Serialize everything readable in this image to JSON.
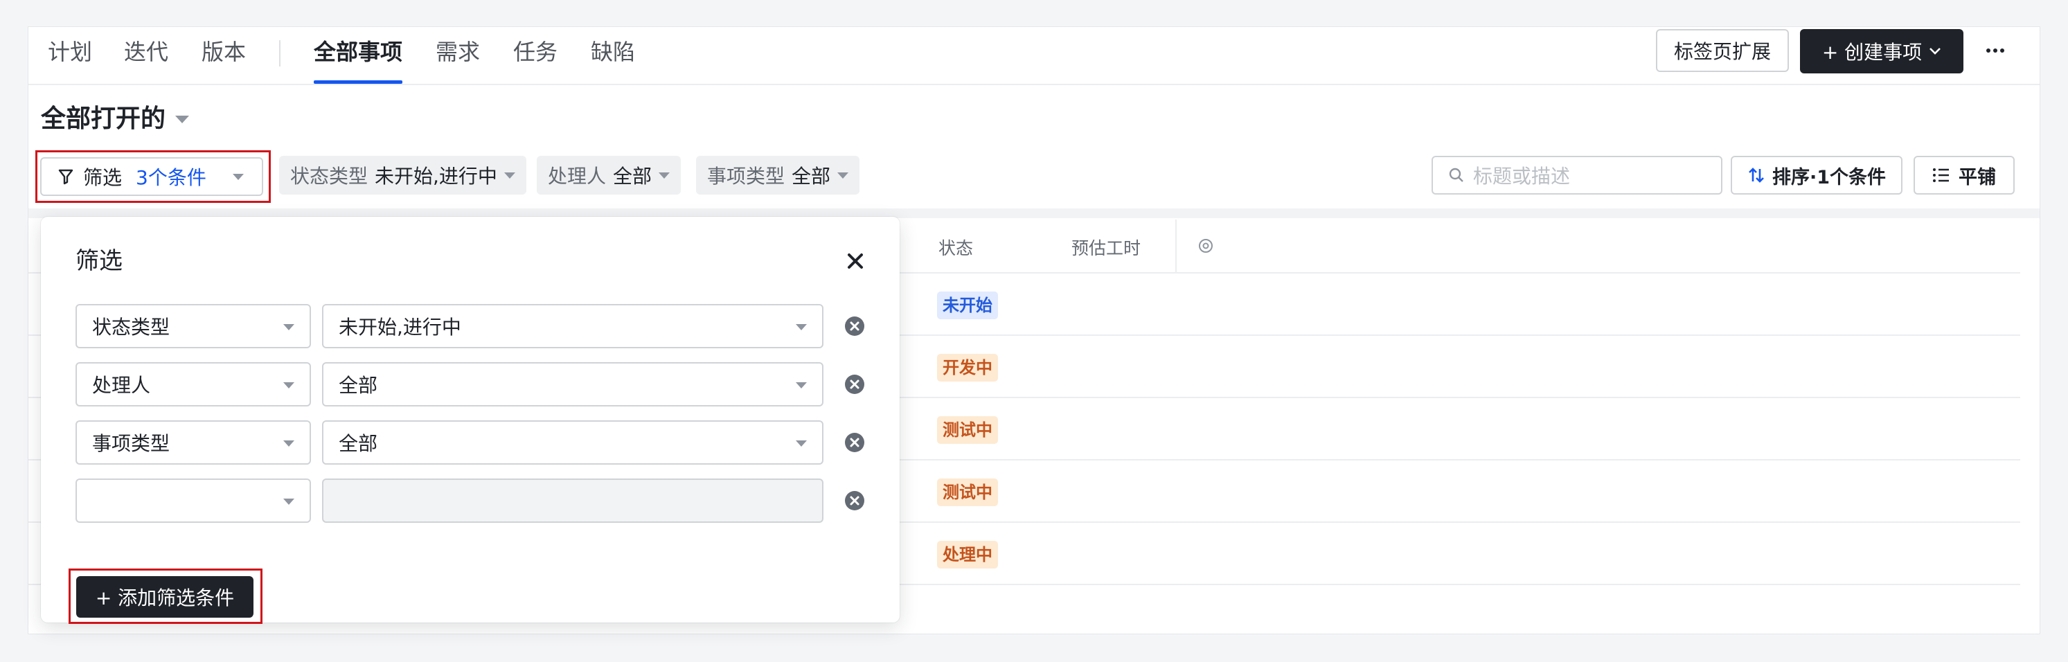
{
  "nav": {
    "items": [
      {
        "label": "计划"
      },
      {
        "label": "迭代"
      },
      {
        "label": "版本"
      },
      {
        "label": "全部事项"
      },
      {
        "label": "需求"
      },
      {
        "label": "任务"
      },
      {
        "label": "缺陷"
      }
    ],
    "active_index": 3,
    "tab_expand_label": "标签页扩展",
    "create_label": "+ 创建事项"
  },
  "view": {
    "title": "全部打开的"
  },
  "filter_bar": {
    "filter_label": "筛选",
    "filter_count": "3个条件",
    "chips": [
      {
        "key": "状态类型",
        "value": "未开始,进行中"
      },
      {
        "key": "处理人",
        "value": "全部"
      },
      {
        "key": "事项类型",
        "value": "全部"
      }
    ],
    "search_placeholder": "标题或描述",
    "sort_label": "排序·1个条件",
    "tile_label": "平铺"
  },
  "table": {
    "columns": [
      "状态",
      "预估工时"
    ],
    "rows": [
      {
        "status": "未开始",
        "tone": "blue"
      },
      {
        "status": "开发中",
        "tone": "orange"
      },
      {
        "status": "测试中",
        "tone": "orange"
      },
      {
        "status": "测试中",
        "tone": "orange"
      },
      {
        "status": "处理中",
        "tone": "orange"
      }
    ]
  },
  "filter_panel": {
    "title": "筛选",
    "conditions": [
      {
        "field": "状态类型",
        "value": "未开始,进行中"
      },
      {
        "field": "处理人",
        "value": "全部"
      },
      {
        "field": "事项类型",
        "value": "全部"
      },
      {
        "field": "",
        "value": ""
      }
    ],
    "add_label": "+ 添加筛选条件"
  },
  "colors": {
    "accent": "#1456f0",
    "dark_button": "#1f2329",
    "highlight_border": "#d0151a",
    "tag_blue_bg": "#e1eaff",
    "tag_orange_bg": "#feead2"
  }
}
